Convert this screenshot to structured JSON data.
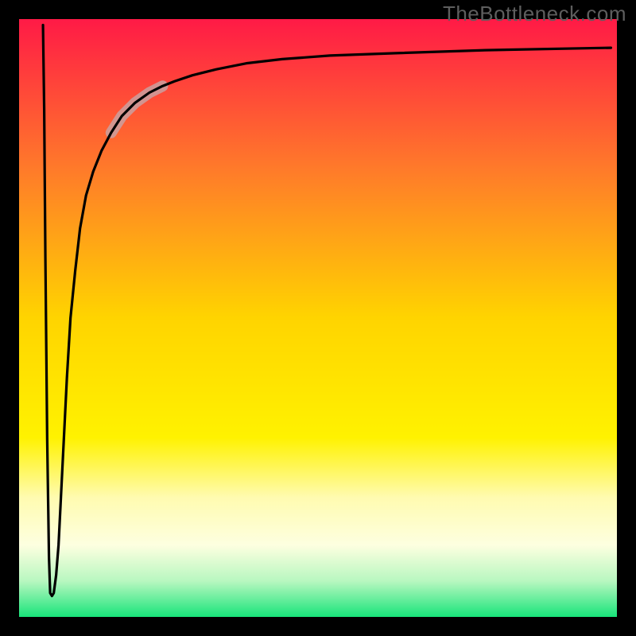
{
  "watermark": "TheBottleneck.com",
  "chart_data": {
    "type": "line",
    "title": "",
    "xlabel": "",
    "ylabel": "",
    "xlim": [
      0,
      100
    ],
    "ylim": [
      0,
      100
    ],
    "grid": false,
    "legend": false,
    "background_gradient": {
      "stops": [
        {
          "offset": 0.0,
          "color": "#ff1a46"
        },
        {
          "offset": 0.25,
          "color": "#ff7a2a"
        },
        {
          "offset": 0.5,
          "color": "#ffd400"
        },
        {
          "offset": 0.7,
          "color": "#fff200"
        },
        {
          "offset": 0.8,
          "color": "#fffbb0"
        },
        {
          "offset": 0.88,
          "color": "#fdffe0"
        },
        {
          "offset": 0.94,
          "color": "#b8f7c0"
        },
        {
          "offset": 1.0,
          "color": "#18e47a"
        }
      ]
    },
    "series": [
      {
        "name": "curve",
        "color": "#000000",
        "stroke_width": 3.2,
        "x": [
          4.0,
          4.2,
          4.4,
          4.7,
          5.0,
          5.2,
          5.5,
          5.8,
          6.2,
          6.6,
          7.0,
          7.5,
          8.0,
          8.6,
          9.4,
          10.2,
          11.2,
          12.4,
          13.8,
          15.4,
          17.2,
          19.4,
          21.8,
          24.0,
          26.0,
          29.0,
          33.0,
          38.0,
          44.0,
          52.0,
          63.0,
          78.0,
          99.0
        ],
        "y": [
          99.0,
          85.0,
          60.0,
          30.0,
          10.0,
          4.0,
          3.5,
          4.0,
          7.0,
          12.0,
          20.0,
          30.0,
          40.0,
          50.0,
          58.0,
          65.0,
          70.5,
          74.5,
          78.0,
          81.0,
          83.8,
          86.0,
          87.7,
          88.8,
          89.6,
          90.6,
          91.6,
          92.6,
          93.3,
          93.9,
          94.3,
          94.8,
          95.2
        ]
      },
      {
        "name": "highlight-segment",
        "color": "#caa0a0",
        "stroke_width": 14,
        "opacity": 0.85,
        "x": [
          15.4,
          17.2,
          19.4,
          21.8,
          24.0
        ],
        "y": [
          81.0,
          83.8,
          86.0,
          87.7,
          88.8
        ]
      }
    ],
    "frame": {
      "color": "#000000",
      "thickness": 24
    }
  }
}
